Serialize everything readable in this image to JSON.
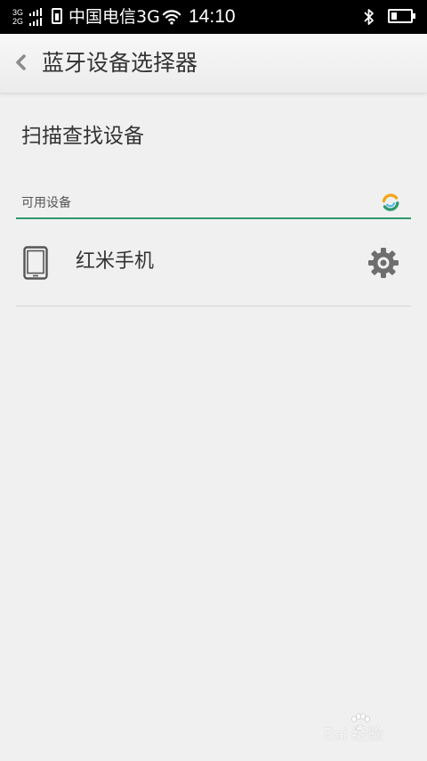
{
  "status_bar": {
    "network_top": "3G",
    "network_bottom": "2G",
    "carrier": "中国电信3G",
    "time": "14:10",
    "battery_level": 0.3,
    "icons": [
      "signal-icon",
      "sim-icon",
      "wifi-icon",
      "bluetooth-icon",
      "battery-icon"
    ]
  },
  "title_bar": {
    "back_icon": "chevron-left-icon",
    "title": "蓝牙设备选择器"
  },
  "scan": {
    "label": "扫描查找设备"
  },
  "available": {
    "header": "可用设备",
    "header_icon": "refresh-icon",
    "accent_color": "#2e9a6b",
    "devices": [
      {
        "name": "红米手机",
        "icon": "phone-icon",
        "action_icon": "gear-icon"
      }
    ]
  },
  "watermark": {
    "text": "Bai 经验",
    "icon": "baidu-paw-icon"
  }
}
